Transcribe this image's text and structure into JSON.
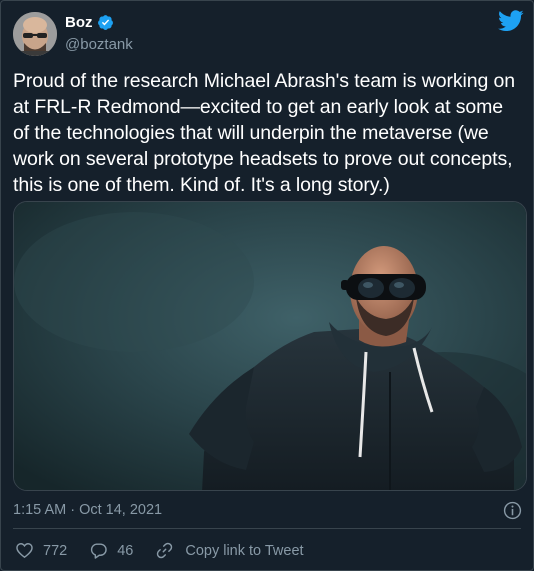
{
  "user": {
    "display_name": "Boz",
    "handle": "@boztank",
    "verified": true
  },
  "tweet": {
    "text": "Proud of the research Michael Abrash's team is working on at FRL-R Redmond—excited to get an early look at some of the technologies that will underpin the metaverse (we work on several prototype headsets to prove out concepts, this is one of them. Kind of. It's a long story.)",
    "timestamp": "1:15 AM · Oct 14, 2021"
  },
  "actions": {
    "like_count": "772",
    "reply_count": "46",
    "copy_link_label": "Copy link to Tweet"
  },
  "icons": {
    "brand": "twitter-bird-icon",
    "verified": "verified-badge-icon",
    "info": "info-icon",
    "like": "heart-icon",
    "reply": "reply-bubble-icon",
    "copy": "link-icon"
  },
  "colors": {
    "background": "#15202b",
    "border": "#38444d",
    "secondary_text": "#8899a6",
    "accent": "#1da1f2"
  }
}
